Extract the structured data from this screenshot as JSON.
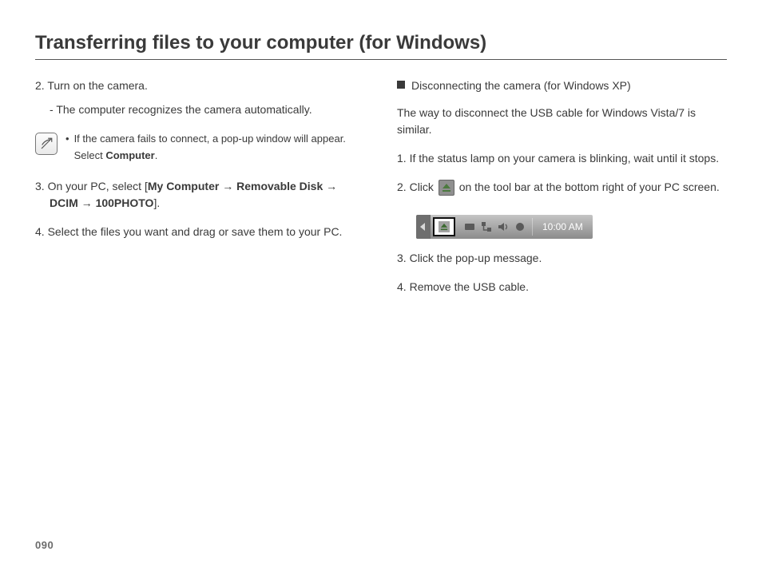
{
  "title": "Transferring files to your computer (for Windows)",
  "page_number": "090",
  "left": {
    "step2_num": "2. ",
    "step2_text": "Turn on the camera.",
    "step2_sub_dash": "- ",
    "step2_sub": "The computer recognizes the camera automatically.",
    "note_bullet": "•",
    "note_line1": "If the camera fails to connect, a pop-up window will appear.",
    "note_line2_a": "Select ",
    "note_line2_b": "Computer",
    "note_line2_c": ".",
    "step3_num": "3. ",
    "step3_a": "On your PC, select [",
    "step3_b1": "My Computer",
    "arrow": " → ",
    "step3_b2": "Removable Disk",
    "step3_b3": "DCIM",
    "step3_b4": "100PHOTO",
    "step3_c": "].",
    "step4_num": "4. ",
    "step4_text": "Select the files you want and drag or save them to your PC."
  },
  "right": {
    "heading": "Disconnecting the camera (for Windows XP)",
    "intro": "The way to disconnect the USB cable for Windows Vista/7 is similar.",
    "step1_num": "1. ",
    "step1_text": "If the status lamp on your camera is blinking, wait until it stops.",
    "step2_num": "2. ",
    "step2_a": "Click ",
    "step2_b": " on the tool bar at the bottom right of your PC screen.",
    "tray_time": "10:00 AM",
    "step3_num": "3. ",
    "step3_text": "Click the pop-up message.",
    "step4_num": "4. ",
    "step4_text": "Remove the USB cable."
  }
}
